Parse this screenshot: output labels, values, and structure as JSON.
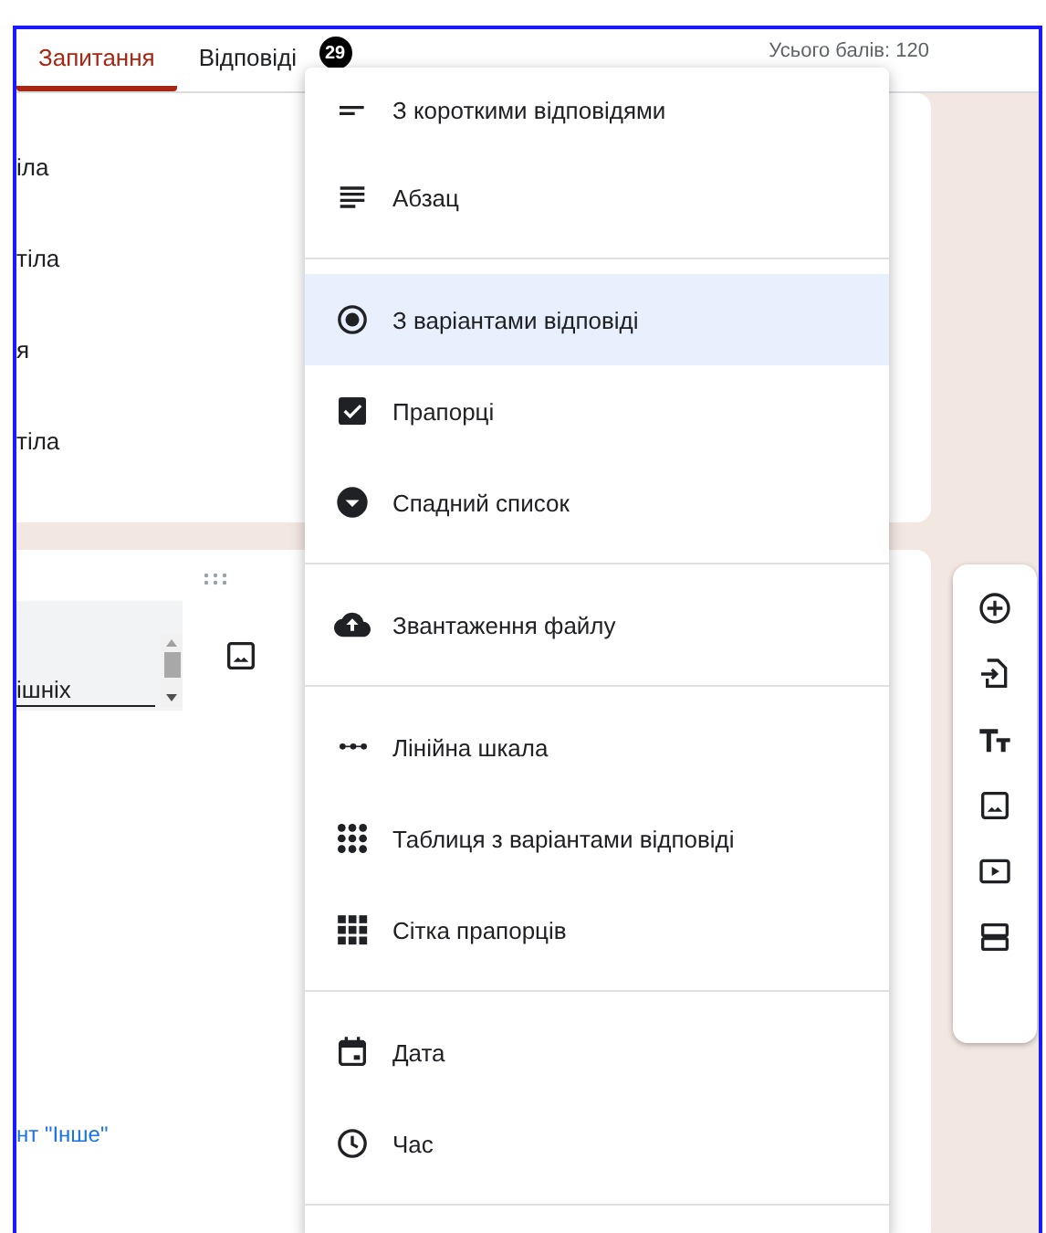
{
  "tabs": [
    {
      "label": "Запитання",
      "selected": true
    },
    {
      "label": "Відповіді",
      "selected": false,
      "badge": "29"
    }
  ],
  "total_points": "Усього балів: 120",
  "question_card": {
    "options": [
      "іла",
      "тіла",
      "я",
      "тіла"
    ]
  },
  "second_card": {
    "field_value": "ішніх",
    "link": "нт \"Інше\""
  },
  "menu": {
    "groups": [
      [
        {
          "kind": "short",
          "label": "З короткими відповідями",
          "selected": false
        },
        {
          "kind": "paragraph",
          "label": "Абзац",
          "selected": false
        }
      ],
      [
        {
          "kind": "radio",
          "label": "З варіантами відповіді",
          "selected": true
        },
        {
          "kind": "checkbox",
          "label": "Прапорці",
          "selected": false
        },
        {
          "kind": "dropdown",
          "label": "Спадний список",
          "selected": false
        }
      ],
      [
        {
          "kind": "upload",
          "label": "Звантаження файлу",
          "selected": false
        }
      ],
      [
        {
          "kind": "scale",
          "label": "Лінійна шкала",
          "selected": false
        },
        {
          "kind": "grid",
          "label": "Таблиця з варіантами відповіді",
          "selected": false
        },
        {
          "kind": "checkgrid",
          "label": "Сітка прапорців",
          "selected": false
        }
      ],
      [
        {
          "kind": "date",
          "label": "Дата",
          "selected": false
        },
        {
          "kind": "time",
          "label": "Час",
          "selected": false
        }
      ]
    ]
  },
  "toolbar": [
    {
      "kind": "add"
    },
    {
      "kind": "import"
    },
    {
      "kind": "title"
    },
    {
      "kind": "image"
    },
    {
      "kind": "video"
    },
    {
      "kind": "section"
    }
  ]
}
